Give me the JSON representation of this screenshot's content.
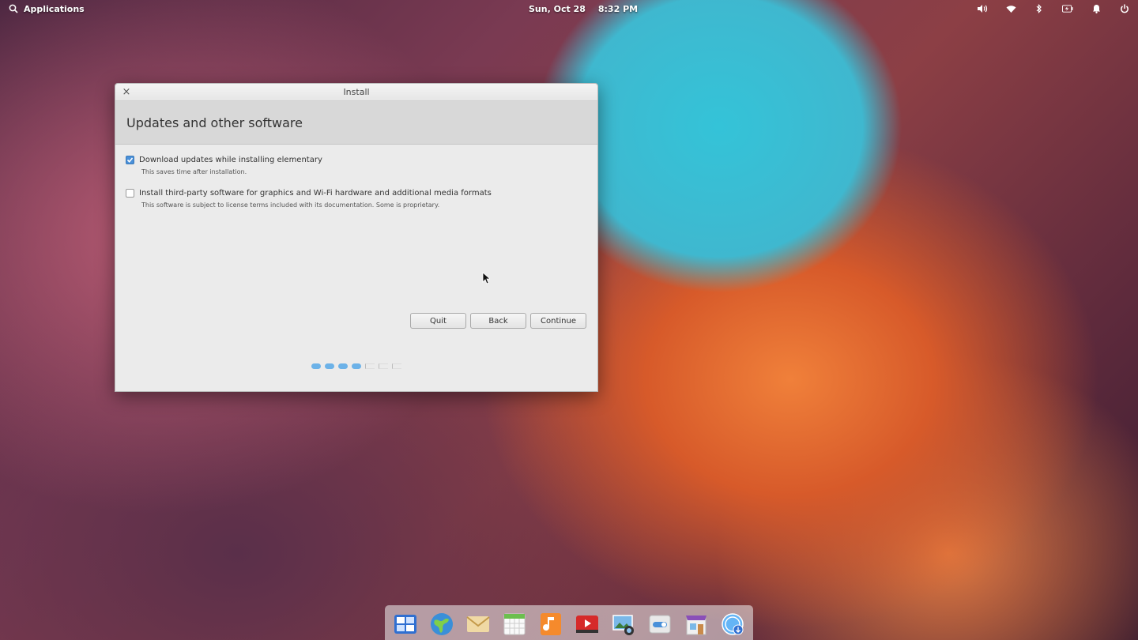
{
  "panel": {
    "applications_label": "Applications",
    "date": "Sun, Oct 28",
    "time": "8:32 PM",
    "icons": [
      "volume-icon",
      "wifi-icon",
      "bluetooth-icon",
      "battery-icon",
      "notification-icon",
      "power-icon"
    ]
  },
  "window": {
    "title": "Install",
    "close_glyph": "×",
    "header_title": "Updates and other software",
    "options": [
      {
        "label": "Download updates while installing elementary",
        "description": "This saves time after installation.",
        "checked": true
      },
      {
        "label": "Install third-party software for graphics and Wi-Fi hardware and additional media formats",
        "description": "This software is subject to license terms included with its documentation. Some is proprietary.",
        "checked": false
      }
    ],
    "buttons": {
      "quit": "Quit",
      "back": "Back",
      "continue": "Continue"
    },
    "progress": {
      "completed_steps": 4,
      "total_steps": 7
    }
  },
  "dock": {
    "apps": [
      "multitasking-view-icon",
      "web-browser-icon",
      "mail-icon",
      "calendar-icon",
      "music-icon",
      "videos-icon",
      "photos-icon",
      "system-settings-icon",
      "app-center-icon",
      "installer-icon"
    ]
  },
  "colors": {
    "accent": "#4a90d9",
    "progress": "#6cb2e8"
  }
}
